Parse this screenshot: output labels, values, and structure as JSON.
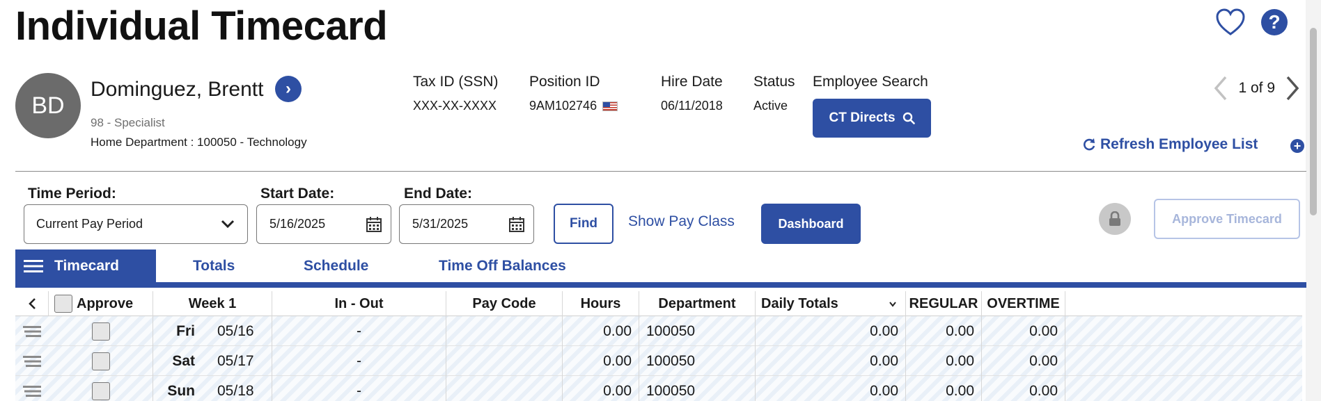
{
  "header": {
    "title": "Individual Timecard"
  },
  "employee": {
    "initials": "BD",
    "name": "Dominguez, Brentt",
    "job": "98 - Specialist",
    "home_department": "Home Department : 100050 - Technology"
  },
  "info": {
    "tax_id_label": "Tax ID (SSN)",
    "tax_id_value": "XXX-XX-XXXX",
    "position_id_label": "Position ID",
    "position_id_value": "9AM102746",
    "hire_date_label": "Hire Date",
    "hire_date_value": "06/11/2018",
    "status_label": "Status",
    "status_value": "Active",
    "employee_search_label": "Employee Search",
    "employee_search_button": "CT Directs"
  },
  "pager": {
    "text": "1 of 9"
  },
  "refresh": {
    "label": "Refresh Employee List"
  },
  "filters": {
    "time_period_label": "Time Period:",
    "time_period_value": "Current Pay Period",
    "start_date_label": "Start Date:",
    "start_date_value": "5/16/2025",
    "end_date_label": "End Date:",
    "end_date_value": "5/31/2025",
    "find_label": "Find",
    "show_pay_class_label": "Show Pay Class",
    "dashboard_label": "Dashboard",
    "approve_timecard_label": "Approve Timecard"
  },
  "tabs": [
    {
      "label": "Timecard"
    },
    {
      "label": "Totals"
    },
    {
      "label": "Schedule"
    },
    {
      "label": "Time Off Balances"
    }
  ],
  "grid": {
    "columns": {
      "approve": "Approve",
      "week": "Week 1",
      "in_out": "In - Out",
      "pay_code": "Pay Code",
      "hours": "Hours",
      "department": "Department",
      "daily_totals": "Daily Totals",
      "regular": "REGULAR",
      "overtime": "OVERTIME"
    },
    "rows": [
      {
        "day": "Fri",
        "date": "05/16",
        "in_out": "-",
        "pay_code": "",
        "hours": "0.00",
        "department": "100050",
        "daily_totals": "0.00",
        "regular": "0.00",
        "overtime": "0.00"
      },
      {
        "day": "Sat",
        "date": "05/17",
        "in_out": "-",
        "pay_code": "",
        "hours": "0.00",
        "department": "100050",
        "daily_totals": "0.00",
        "regular": "0.00",
        "overtime": "0.00"
      },
      {
        "day": "Sun",
        "date": "05/18",
        "in_out": "-",
        "pay_code": "",
        "hours": "0.00",
        "department": "100050",
        "daily_totals": "0.00",
        "regular": "0.00",
        "overtime": "0.00"
      }
    ]
  },
  "colors": {
    "accent": "#2e4fa3",
    "avatar": "#6b6b6b",
    "disabled": "#a7b6db"
  },
  "icons": [
    "heart-icon",
    "help-icon",
    "chevron-right-circle-icon",
    "flag-icon",
    "search-icon",
    "chevron-left-icon",
    "chevron-right-icon",
    "refresh-icon",
    "add-icon",
    "chevron-down-icon",
    "calendar-icon",
    "lock-icon",
    "menu-icon",
    "drag-handle-icon"
  ]
}
